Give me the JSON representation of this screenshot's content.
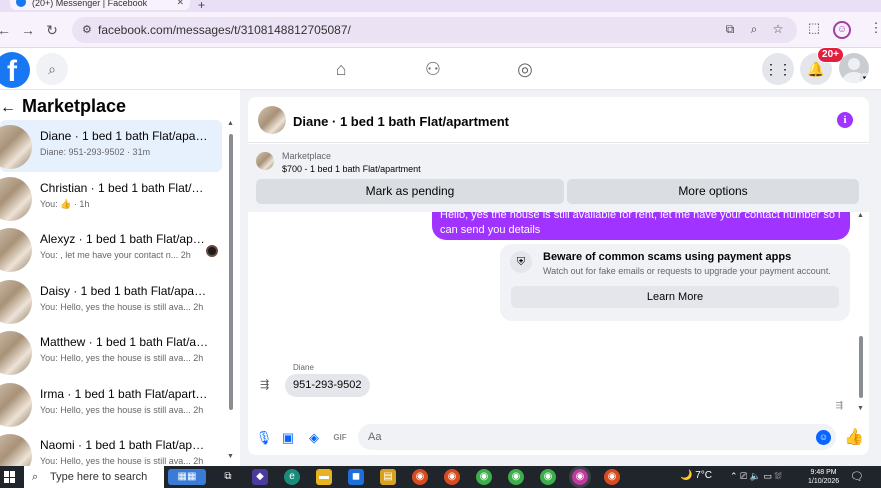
{
  "browser": {
    "tab_title": "(20+) Messenger | Facebook",
    "url": "facebook.com/messages/t/31081488127050​87/"
  },
  "header": {
    "notification_badge": "20+"
  },
  "sidebar": {
    "title": "Marketplace",
    "conversations": [
      {
        "name": "Diane · 1 bed 1 bath Flat/apartm...",
        "preview": "Diane: 951-293-9502 · 31m",
        "active": true
      },
      {
        "name": "Christian · 1 bed 1 bath Flat/apar...",
        "preview": "You: 👍 · 1h"
      },
      {
        "name": "Alexyz · 1 bed 1 bath Flat/apar...",
        "preview": "You: , let me have your contact n... 2h",
        "unread": true
      },
      {
        "name": "Daisy · 1 bed 1 bath Flat/apartm...",
        "preview": "You: Hello, yes the house is still ava... 2h"
      },
      {
        "name": "Matthew · 1 bed 1 bath Flat/apar...",
        "preview": "You: Hello, yes the house is still ava... 2h"
      },
      {
        "name": "Irma · 1 bed 1 bath Flat/apartment",
        "preview": "You: Hello, yes the house is still ava... 2h"
      },
      {
        "name": "Naomi · 1 bed 1 bath Flat/apart...",
        "preview": "You: Hello, yes the house is still ava... 2h"
      }
    ]
  },
  "chat": {
    "title": "Diane · 1 bed 1 bath Flat/apartment",
    "marketplace_label": "Marketplace",
    "listing": "$700 - 1 bed 1 bath Flat/apartment",
    "mark_pending": "Mark as pending",
    "more_options": "More options",
    "outgoing_message": "Hello, yes the house is still available for rent, let me have your contact number so i can send you details",
    "scam_title": "Beware of common scams using payment apps",
    "scam_text": "Watch out for fake emails or requests to upgrade your payment account.",
    "learn_more": "Learn More",
    "sender_name": "Diane",
    "incoming_message": "951-293-9502",
    "composer_placeholder": "Aa"
  },
  "taskbar": {
    "search_placeholder": "Type here to search",
    "temperature": "7°C",
    "time": "9:48 PM",
    "date": "1/10/2026"
  },
  "colors": {
    "fb_blue": "#1877f2",
    "messenger_purple": "#a033ff",
    "active_row": "#e7f0fd"
  }
}
